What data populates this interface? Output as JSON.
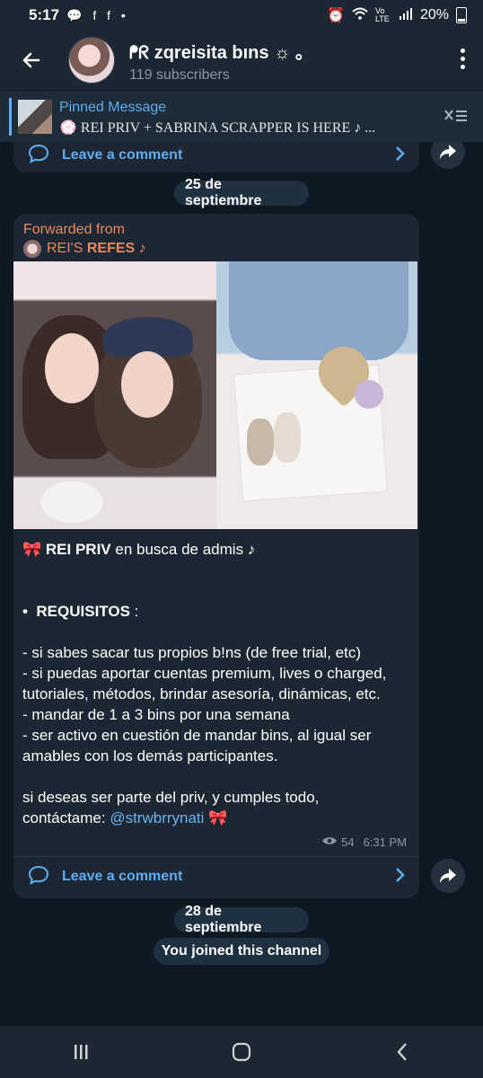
{
  "status_bar": {
    "time": "5:17",
    "notif_icons": "💬 f f •",
    "network": "Vo LTE",
    "battery": "20%"
  },
  "header": {
    "title": "ᖰᖇ zqreisita bıns ☼ ｡",
    "subscribers": "119 subscribers"
  },
  "pinned": {
    "title": "Pinned Message",
    "text": "💮 REI PRIV + SABRINA SCRAPPER IS HERE ♪ ..."
  },
  "prev_post": {
    "comment_label": "Leave a comment"
  },
  "date1": "25 de septiembre",
  "post": {
    "forwarded_label": "Forwarded from",
    "source_prefix": "REI'S",
    "source_bold": "REFES",
    "source_suffix": "♪",
    "line1_emoji": "🎀",
    "line1_bold": "REI PRIV",
    "line1_rest": " en busca de admis  ♪",
    "req_bullet": "•",
    "req_title": "REQUISITOS",
    "req_colon": " :",
    "items": [
      "- si sabes sacar tus propios b!ns (de free trial, etc)",
      "- si puedas aportar cuentas premium, lives o charged, tutoriales, métodos, brindar asesoría, dinámicas, etc.",
      "- mandar de 1 a 3 bins por una semana",
      "- ser activo en cuestión de mandar bins, al igual ser amables con los demás participantes."
    ],
    "closing1": "si deseas ser parte del priv, y cumples todo,",
    "closing2": "contáctame: ",
    "handle": "@strwbrrynati",
    "closing_emoji": " 🎀",
    "views": "54",
    "time": "6:31 PM",
    "comment_label": "Leave a comment"
  },
  "date2": "28 de septiembre",
  "joined": "You joined this channel",
  "colors": {
    "accent": "#5eaef0",
    "forward": "#e9895d",
    "bubble": "#1c2733",
    "background": "#0e1822"
  },
  "icons": [
    "back-arrow-icon",
    "more-vert-icon",
    "unpin-icon",
    "comment-icon",
    "chevron-right-icon",
    "share-icon",
    "eye-icon",
    "recent-apps-icon",
    "home-icon",
    "back-nav-icon"
  ]
}
